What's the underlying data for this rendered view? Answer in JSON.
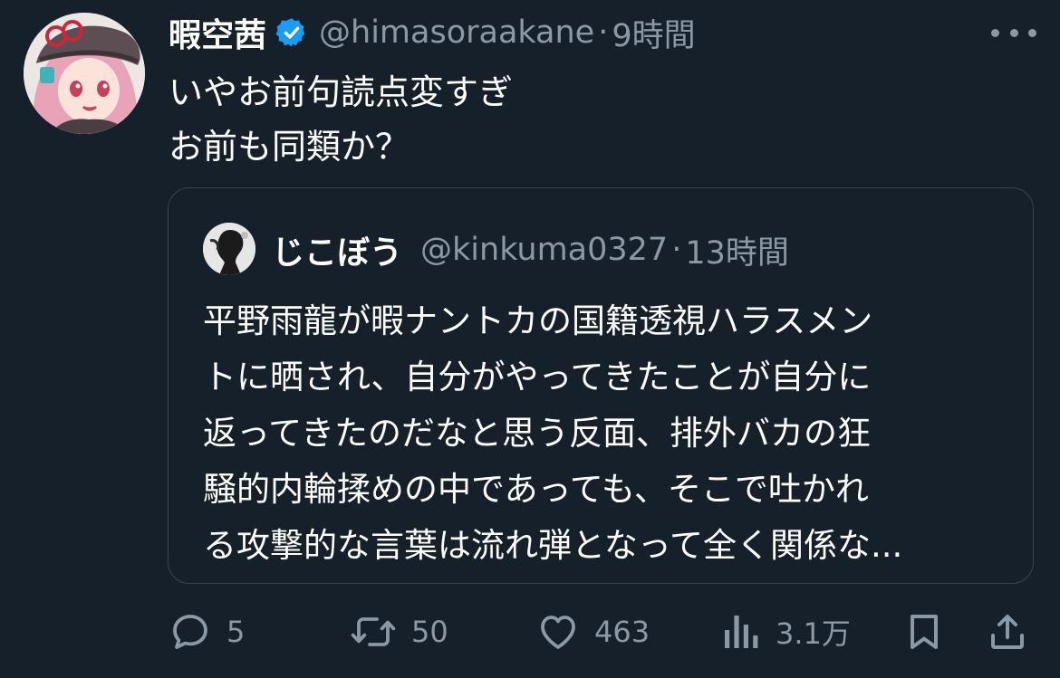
{
  "author": {
    "display_name": "暇空茜",
    "handle": "@himasoraakane",
    "separator": "·",
    "time": "9時間",
    "verified_color": "#1d9bf0"
  },
  "tweet": {
    "lines": [
      "いやお前句読点変すぎ",
      "お前も同類か？"
    ]
  },
  "quoted": {
    "display_name": "じこぼう",
    "handle": "@kinkuma0327",
    "separator": "·",
    "time": "13時間",
    "lines": [
      "平野雨龍が暇ナントカの国籍透視ハラスメン",
      "トに晒され、自分がやってきたことが自分に",
      "返ってきたのだなと思う反面、排外バカの狂",
      "騒的内輪揉めの中であっても、そこで吐かれ",
      "る攻撃的な言葉は流れ弾となって全く関係な..."
    ]
  },
  "actions": {
    "replies": "5",
    "reposts": "50",
    "likes": "463",
    "views": "3.1万"
  },
  "icons": {
    "reply": "reply-icon",
    "repost": "repost-icon",
    "like": "like-icon",
    "views": "views-icon",
    "bookmark": "bookmark-icon",
    "share": "share-icon",
    "more": "more-icon",
    "verified": "verified-badge-icon"
  },
  "colors": {
    "background": "#15202b",
    "text": "#ffffff",
    "secondary": "#8b98a5",
    "border": "#38444d"
  }
}
